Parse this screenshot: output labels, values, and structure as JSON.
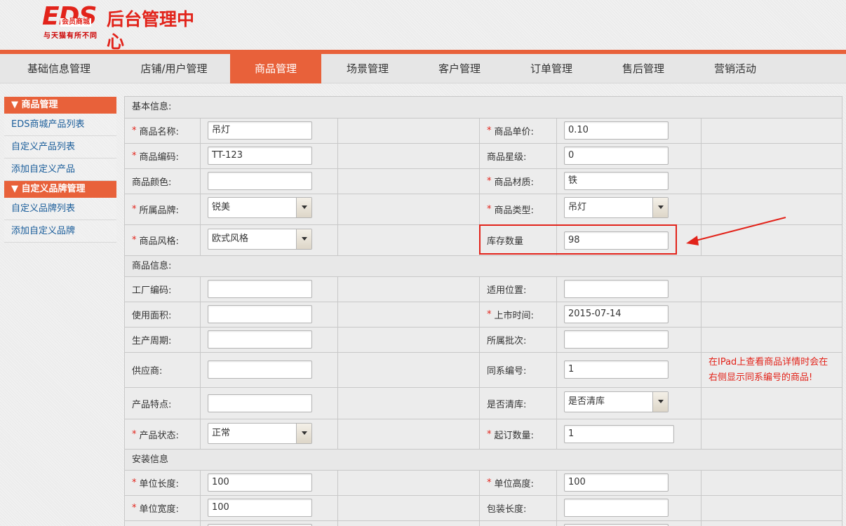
{
  "brand": {
    "logo_text": "EDS",
    "logo_sub": "会员商城",
    "slogan": "与天猫有所不同",
    "title": "后台管理中心"
  },
  "nav": {
    "items": [
      {
        "label": "基础信息管理"
      },
      {
        "label": "店铺/用户管理"
      },
      {
        "label": "商品管理"
      },
      {
        "label": "场景管理"
      },
      {
        "label": "客户管理"
      },
      {
        "label": "订单管理"
      },
      {
        "label": "售后管理"
      },
      {
        "label": "营销活动"
      }
    ],
    "active_index": 2
  },
  "sidebar": {
    "groups": [
      {
        "title": "▼ 商品管理",
        "items": [
          "EDS商城产品列表",
          "自定义产品列表",
          "添加自定义产品"
        ]
      },
      {
        "title": "▼ 自定义品牌管理",
        "items": [
          "自定义品牌列表",
          "添加自定义品牌"
        ]
      }
    ]
  },
  "form": {
    "sections": {
      "basic": "基本信息:",
      "product": "商品信息:",
      "install": "安装信息"
    },
    "fields": {
      "name": {
        "label": "商品名称:",
        "value": "吊灯",
        "required": true
      },
      "price": {
        "label": "商品单价:",
        "value": "0.10",
        "required": true
      },
      "code": {
        "label": "商品编码:",
        "value": "TT-123",
        "required": true
      },
      "star": {
        "label": "商品星级:",
        "value": "0",
        "required": false
      },
      "color": {
        "label": "商品颜色:",
        "value": "",
        "required": false
      },
      "material": {
        "label": "商品材质:",
        "value": "铁",
        "required": true
      },
      "brand": {
        "label": "所属品牌:",
        "value": "锐美",
        "required": true
      },
      "type": {
        "label": "商品类型:",
        "value": "吊灯",
        "required": true
      },
      "style": {
        "label": "商品风格:",
        "value": "欧式风格",
        "required": true
      },
      "stock": {
        "label": "库存数量",
        "value": "98",
        "required": false
      },
      "factory_code": {
        "label": "工厂编码:",
        "value": ""
      },
      "position": {
        "label": "适用位置:",
        "value": ""
      },
      "area": {
        "label": "使用面积:",
        "value": ""
      },
      "launch_date": {
        "label": "上市时间:",
        "value": "2015-07-14",
        "required": true
      },
      "cycle": {
        "label": "生产周期:",
        "value": ""
      },
      "batch": {
        "label": "所属批次:",
        "value": ""
      },
      "supplier": {
        "label": "供应商:",
        "value": ""
      },
      "series": {
        "label": "同系编号:",
        "value": "1"
      },
      "features": {
        "label": "产品特点:",
        "value": ""
      },
      "clearance": {
        "label": "是否清库:",
        "value": "是否清库"
      },
      "status": {
        "label": "产品状态:",
        "value": "正常",
        "required": true
      },
      "min_order": {
        "label": "起订数量:",
        "value": "1",
        "required": true
      },
      "unit_length": {
        "label": "单位长度:",
        "value": "100",
        "required": true
      },
      "unit_height": {
        "label": "单位高度:",
        "value": "100",
        "required": true
      },
      "unit_width": {
        "label": "单位宽度:",
        "value": "100",
        "required": true
      },
      "pack_length": {
        "label": "包装长度:",
        "value": ""
      }
    },
    "star_mark": "*",
    "annotation": "在IPad上查看商品详情时会在右侧显示同系编号的商品!"
  },
  "colors": {
    "accent": "#e8613a",
    "required": "#e2231a",
    "highlight": "#e2231a"
  }
}
